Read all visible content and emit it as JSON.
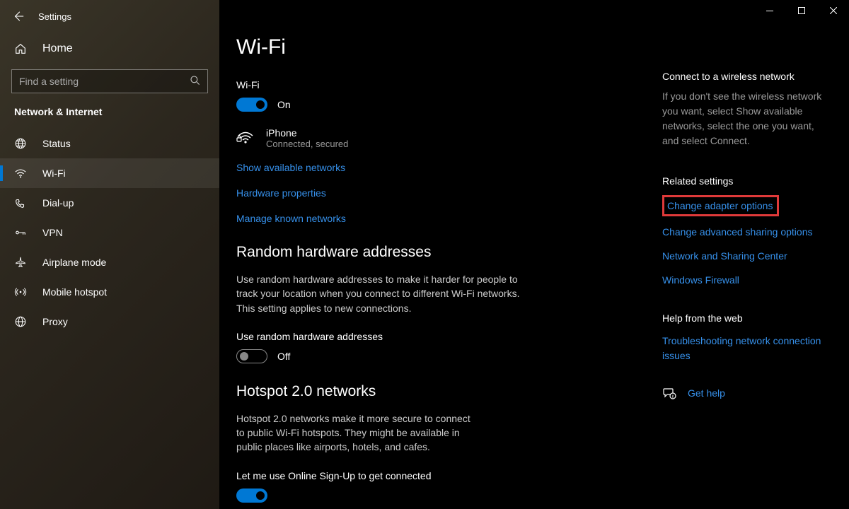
{
  "appTitle": "Settings",
  "search": {
    "placeholder": "Find a setting"
  },
  "home": {
    "label": "Home"
  },
  "category": "Network & Internet",
  "nav": [
    {
      "label": "Status"
    },
    {
      "label": "Wi-Fi"
    },
    {
      "label": "Dial-up"
    },
    {
      "label": "VPN"
    },
    {
      "label": "Airplane mode"
    },
    {
      "label": "Mobile hotspot"
    },
    {
      "label": "Proxy"
    }
  ],
  "page": {
    "title": "Wi-Fi",
    "wifi": {
      "label": "Wi-Fi",
      "stateText": "On"
    },
    "network": {
      "name": "iPhone",
      "status": "Connected, secured"
    },
    "links": {
      "showNetworks": "Show available networks",
      "hwProps": "Hardware properties",
      "manageKnown": "Manage known networks"
    },
    "random": {
      "title": "Random hardware addresses",
      "desc": "Use random hardware addresses to make it harder for people to track your location when you connect to different Wi-Fi networks. This setting applies to new connections.",
      "toggleLabel": "Use random hardware addresses",
      "stateText": "Off"
    },
    "hotspot": {
      "title": "Hotspot 2.0 networks",
      "desc": "Hotspot 2.0 networks make it more secure to connect to public Wi-Fi hotspots. They might be available in public places like airports, hotels, and cafes.",
      "toggleLabel": "Let me use Online Sign-Up to get connected"
    }
  },
  "side": {
    "connect": {
      "title": "Connect to a wireless network",
      "desc": "If you don't see the wireless network you want, select Show available networks, select the one you want, and select Connect."
    },
    "related": {
      "title": "Related settings",
      "adapter": "Change adapter options",
      "sharing": "Change advanced sharing options",
      "center": "Network and Sharing Center",
      "firewall": "Windows Firewall"
    },
    "help": {
      "title": "Help from the web",
      "troubleshoot": "Troubleshooting network connection issues",
      "getHelp": "Get help"
    }
  }
}
